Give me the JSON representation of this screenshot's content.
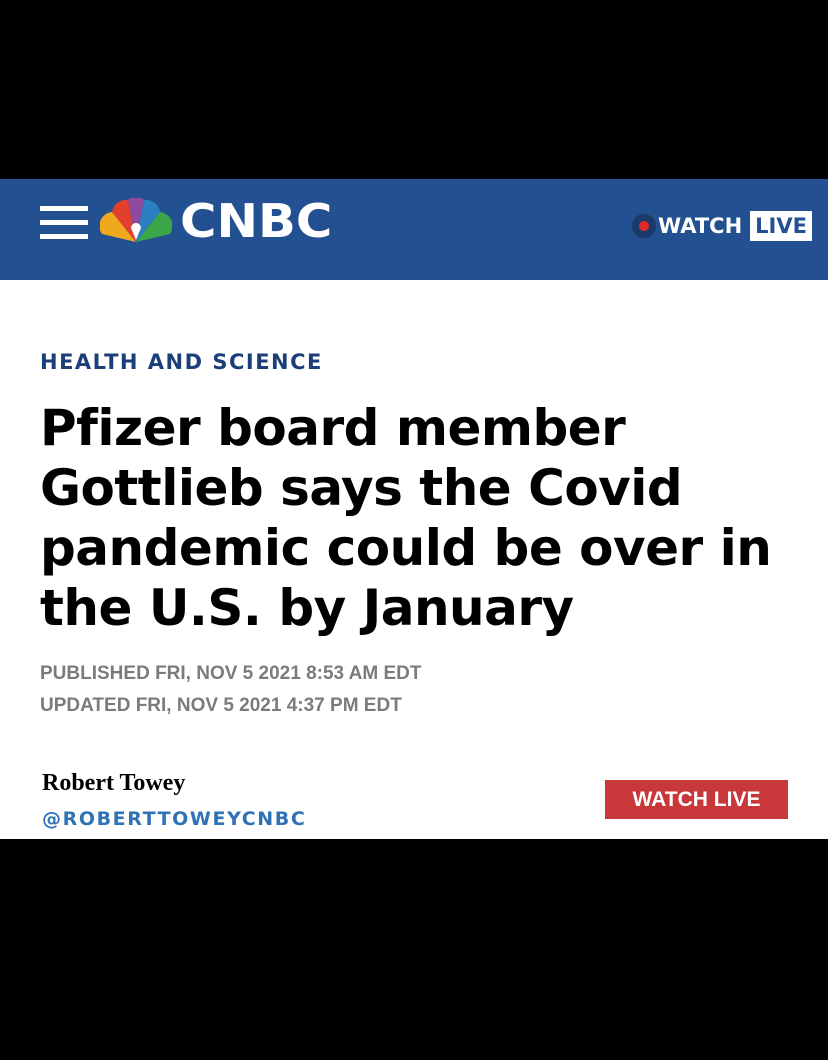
{
  "header": {
    "brand": "CNBC",
    "watch_label": "WATCH",
    "live_label": "LIVE",
    "menu_icon": "hamburger-menu-icon",
    "logo_icon": "nbc-peacock-logo"
  },
  "article": {
    "section": "HEALTH AND SCIENCE",
    "headline": "Pfizer board member Gottlieb says the Covid pandemic could be over in the U.S. by January",
    "published": "PUBLISHED FRI, NOV 5 2021 8:53 AM EDT",
    "updated": "UPDATED FRI, NOV 5 2021 4:37 PM EDT",
    "author_name": "Robert Towey",
    "author_handle": "@ROBERTTOWEYCNBC",
    "watch_live_button": "WATCH LIVE"
  },
  "colors": {
    "header_bg": "#225091",
    "section_label": "#1c3f7a",
    "handle": "#2f72b5",
    "button_bg": "#c8373a",
    "live_dot": "#e02a2a"
  }
}
